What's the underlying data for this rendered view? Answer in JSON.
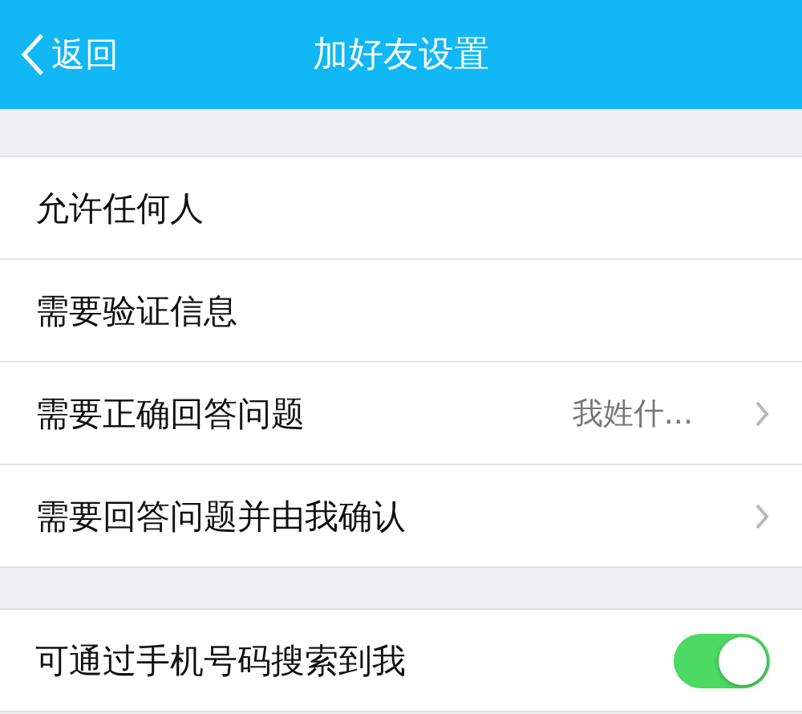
{
  "nav": {
    "back": "返回",
    "title": "加好友设置"
  },
  "options": [
    {
      "label": "允许任何人",
      "kind": "plain"
    },
    {
      "label": "需要验证信息",
      "kind": "plain"
    },
    {
      "label": "需要正确回答问题",
      "kind": "link",
      "value": "我姓什..."
    },
    {
      "label": "需要回答问题并由我确认",
      "kind": "link"
    }
  ],
  "phone_search": {
    "label": "可通过手机号码搜索到我",
    "on": true
  }
}
